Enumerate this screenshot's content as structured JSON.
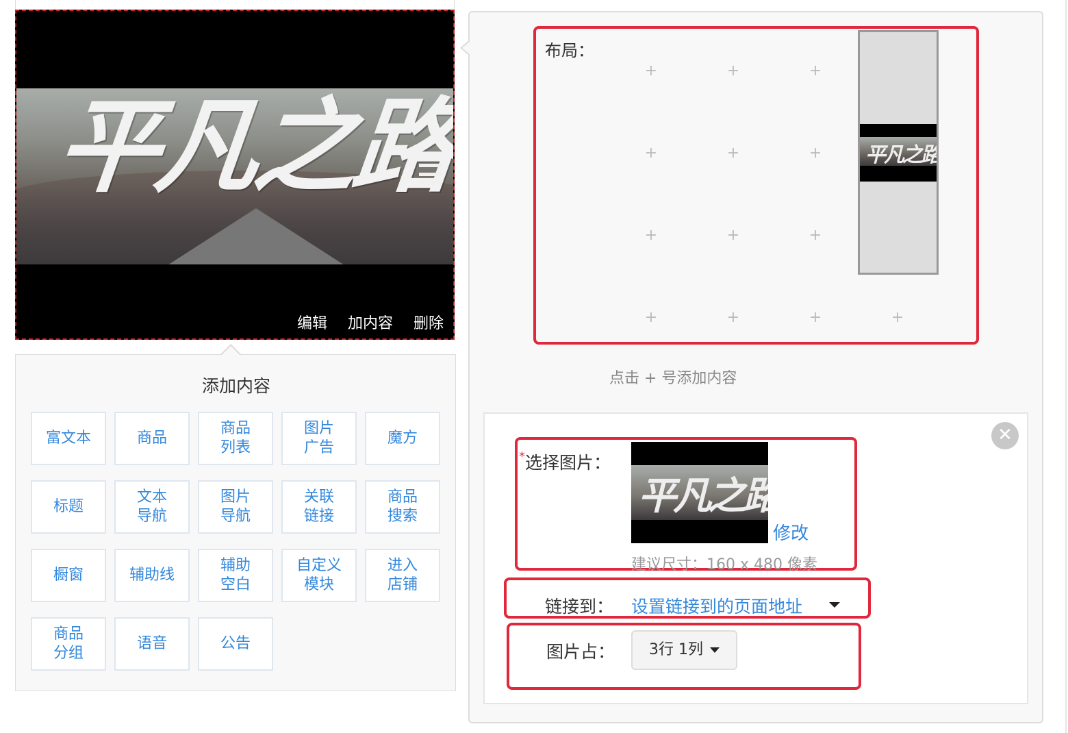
{
  "preview": {
    "banner_text": "平凡之路",
    "actions": {
      "edit": "编辑",
      "add_content": "加内容",
      "delete": "删除"
    }
  },
  "add_panel": {
    "title": "添加内容",
    "buttons": [
      {
        "l1": "富文本",
        "l2": ""
      },
      {
        "l1": "商品",
        "l2": ""
      },
      {
        "l1": "商品",
        "l2": "列表"
      },
      {
        "l1": "图片",
        "l2": "广告"
      },
      {
        "l1": "魔方",
        "l2": ""
      },
      {
        "l1": "标题",
        "l2": ""
      },
      {
        "l1": "文本",
        "l2": "导航"
      },
      {
        "l1": "图片",
        "l2": "导航"
      },
      {
        "l1": "关联",
        "l2": "链接"
      },
      {
        "l1": "商品",
        "l2": "搜索"
      },
      {
        "l1": "橱窗",
        "l2": ""
      },
      {
        "l1": "辅助线",
        "l2": ""
      },
      {
        "l1": "辅助",
        "l2": "空白"
      },
      {
        "l1": "自定义",
        "l2": "模块"
      },
      {
        "l1": "进入",
        "l2": "店铺"
      },
      {
        "l1": "商品",
        "l2": "分组"
      },
      {
        "l1": "语音",
        "l2": ""
      },
      {
        "l1": "公告",
        "l2": ""
      }
    ]
  },
  "layout": {
    "label": "布局：",
    "plus_symbol": "+",
    "hint": "点击 + 号添加内容",
    "block_text": "平凡之路"
  },
  "settings": {
    "close_symbol": "✕",
    "required_mark": "*",
    "select_image_label": "选择图片：",
    "thumb_text": "平凡之路",
    "modify_link": "修改",
    "size_hint": "建议尺寸：160 x 480 像素",
    "link_label": "链接到：",
    "link_value": "设置链接到的页面地址",
    "occupy_label": "图片占：",
    "occupy_value": "3行 1列"
  },
  "colors": {
    "accent_blue": "#3388dd",
    "highlight_red": "#e0283c",
    "dashed_border": "#c81e1e"
  }
}
